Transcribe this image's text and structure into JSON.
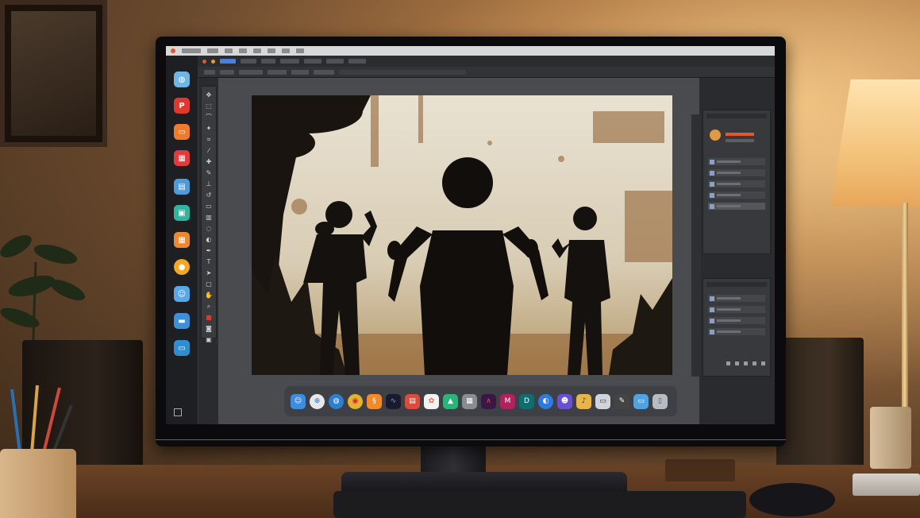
{
  "left_dock": {
    "apps": [
      {
        "icon": "globe-icon",
        "label": "",
        "color": "#6fb6e8"
      },
      {
        "icon": "pinterest-icon",
        "label": "",
        "color": "#e0382e"
      },
      {
        "icon": "folder-icon",
        "label": "",
        "color": "#f07b2c"
      },
      {
        "icon": "calendar-icon",
        "label": "",
        "color": "#e23b3b"
      },
      {
        "icon": "window-icon",
        "label": "",
        "color": "#4f9ad8"
      },
      {
        "icon": "photos-icon",
        "label": "",
        "color": "#2fb5a0"
      },
      {
        "icon": "grid-icon",
        "label": "",
        "color": "#e98a32"
      },
      {
        "icon": "chat-icon",
        "label": "",
        "color": "#f5a623"
      },
      {
        "icon": "finder-icon",
        "label": "",
        "color": "#5aa7e8"
      },
      {
        "icon": "files-icon",
        "label": "",
        "color": "#3d8fd8"
      },
      {
        "icon": "terminal-icon",
        "label": "",
        "color": "#2f8ed0"
      }
    ]
  },
  "colors": {
    "accent_orange": "#e2572b",
    "workspace": "#4a4b4e",
    "panel": "#38393c"
  },
  "bottom_dock": {
    "apps": [
      {
        "icon": "finder-icon",
        "color": "#3c8de0"
      },
      {
        "icon": "safari-icon",
        "color": "#e8e8e8"
      },
      {
        "icon": "globe-icon",
        "color": "#2f7fd1"
      },
      {
        "icon": "chrome-icon",
        "color": "#e3b22e"
      },
      {
        "icon": "app-orange-icon",
        "color": "#f08a2c"
      },
      {
        "icon": "waveform-icon",
        "color": "#1a1a2e"
      },
      {
        "icon": "app-red-icon",
        "color": "#d94b3b"
      },
      {
        "icon": "photos-icon",
        "color": "#f2f2f2"
      },
      {
        "icon": "app-green-icon",
        "color": "#2db37a"
      },
      {
        "icon": "app-gray-icon",
        "color": "#8a8c90"
      },
      {
        "icon": "app-purple-icon",
        "color": "#3a1846"
      },
      {
        "icon": "app-magenta-icon",
        "color": "#b3205e"
      },
      {
        "icon": "app-teal-icon",
        "color": "#0f6d6d"
      },
      {
        "icon": "app-blue-icon",
        "color": "#2d7be0"
      },
      {
        "icon": "app-violet-icon",
        "color": "#6a4fd0"
      },
      {
        "icon": "app-yellow-icon",
        "color": "#e7b64a"
      },
      {
        "icon": "preview-icon",
        "color": "#d0d4da"
      },
      {
        "icon": "pen-icon",
        "color": "#444"
      },
      {
        "icon": "folder-icon",
        "color": "#4fa3e0"
      },
      {
        "icon": "trash-icon",
        "color": "#b7bcc2"
      }
    ]
  }
}
